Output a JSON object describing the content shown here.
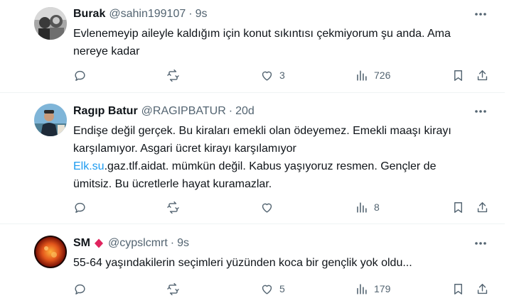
{
  "tweets": [
    {
      "name": "Burak",
      "handle": "@sahin199107",
      "dot": "·",
      "time": "9s",
      "text_lines": [
        "Evlenemeyip aileyle kaldığım için konut sıkıntısı çekmiyorum şu anda. Ama",
        "nereye kadar"
      ],
      "replies": "",
      "retweets": "",
      "likes": "3",
      "views": "726"
    },
    {
      "name": "Ragıp Batur",
      "handle": "@RAGIPBATUR",
      "dot": "·",
      "time": "20d",
      "text_lines": [
        "Endişe değil gerçek. Bu kiraları emekli olan ödeyemez. Emekli maaşı kirayı",
        "karşılamıyor. Asgari ücret kirayı karşılamıyor"
      ],
      "link": "Elk.su",
      "line3_rest": ".gaz.tlf.aidat. mümkün değil. Kabus yaşıyoruz resmen. Gençler de",
      "line4": "ümitsiz. Bu ücretlerle hayat kuramazlar.",
      "replies": "",
      "retweets": "",
      "likes": "",
      "views": "8"
    },
    {
      "name": "SM",
      "handle": "@cypslcmrt",
      "dot": "·",
      "time": "9s",
      "text_lines": [
        "55-64 yaşındakilerin seçimleri yüzünden koca bir gençlik yok oldu..."
      ],
      "replies": "",
      "retweets": "",
      "likes": "5",
      "views": "179"
    }
  ],
  "icons": {
    "more": "more-dots-icon",
    "reply": "reply-icon",
    "retweet": "retweet-icon",
    "like": "heart-icon",
    "views": "views-bar-chart-icon",
    "bookmark": "bookmark-icon",
    "share": "share-icon",
    "badge": "red-diamond-icon"
  },
  "colors": {
    "text": "#0f1419",
    "secondary": "#536471",
    "link": "#1d9bf0",
    "badge": "#e0245e",
    "divider": "#eff3f4"
  }
}
